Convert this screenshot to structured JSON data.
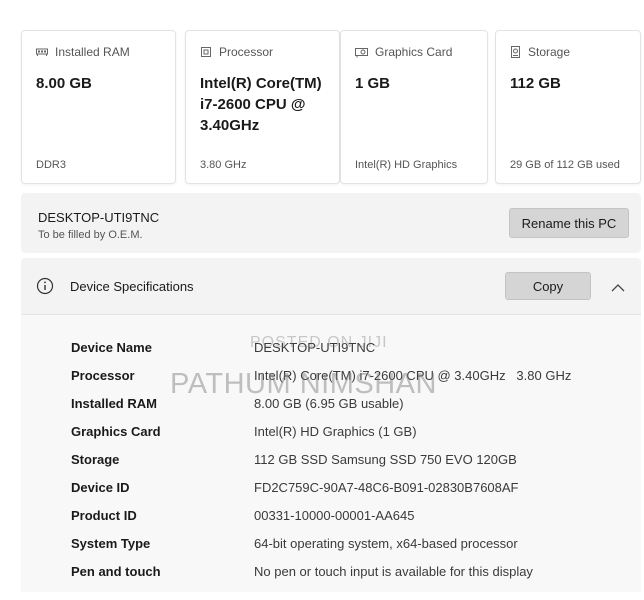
{
  "cards": [
    {
      "title": "Installed RAM",
      "icon": "ram-icon",
      "value": "8.00 GB",
      "sub": "DDR3"
    },
    {
      "title": "Processor",
      "icon": "processor-icon",
      "value": "Intel(R) Core(TM) i7-2600 CPU @ 3.40GHz",
      "sub": "3.80 GHz"
    },
    {
      "title": "Graphics Card",
      "icon": "graphics-card-icon",
      "value": "1 GB",
      "sub": "Intel(R) HD Graphics"
    },
    {
      "title": "Storage",
      "icon": "storage-icon",
      "value": "112 GB",
      "sub": "29 GB of 112 GB used"
    }
  ],
  "pc": {
    "name": "DESKTOP-UTI9TNC",
    "sub": "To be filled by O.E.M.",
    "rename_label": "Rename this PC"
  },
  "device_specs": {
    "title": "Device Specifications",
    "copy_label": "Copy",
    "rows": [
      {
        "label": "Device Name",
        "value": "DESKTOP-UTI9TNC"
      },
      {
        "label": "Processor",
        "value": "Intel(R) Core(TM) i7-2600 CPU @ 3.40GHz   3.80 GHz"
      },
      {
        "label": "Installed RAM",
        "value": "8.00 GB (6.95 GB usable)"
      },
      {
        "label": "Graphics Card",
        "value": "Intel(R) HD Graphics (1 GB)"
      },
      {
        "label": "Storage",
        "value": "112 GB SSD Samsung SSD 750 EVO 120GB"
      },
      {
        "label": "Device ID",
        "value": "FD2C759C-90A7-48C6-B091-02830B7608AF"
      },
      {
        "label": "Product ID",
        "value": "00331-10000-00001-AA645"
      },
      {
        "label": "System Type",
        "value": "64-bit operating system, x64-based processor"
      },
      {
        "label": "Pen and touch",
        "value": "No pen or touch input is available for this display"
      }
    ]
  },
  "watermark": {
    "small": "POSTED ON JIJI",
    "large": "PATHUM NIMSHAN"
  }
}
